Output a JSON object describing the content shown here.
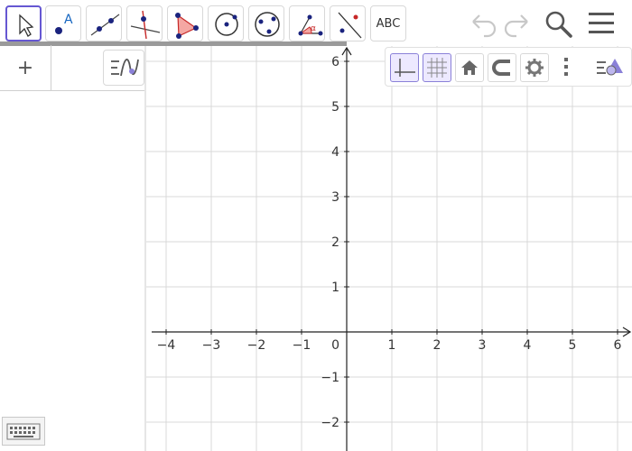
{
  "toolbar": {
    "tools": [
      {
        "name": "move-tool",
        "icon": "pointer-arrow-icon",
        "active": true
      },
      {
        "name": "point-tool",
        "icon": "point-icon"
      },
      {
        "name": "line-tool",
        "icon": "line-through-two-points-icon"
      },
      {
        "name": "perpendicular-tool",
        "icon": "perpendicular-line-icon"
      },
      {
        "name": "polygon-tool",
        "icon": "polygon-icon"
      },
      {
        "name": "circle-tool",
        "icon": "circle-center-point-icon"
      },
      {
        "name": "circle-three-points-tool",
        "icon": "circle-three-points-icon"
      },
      {
        "name": "angle-tool",
        "icon": "angle-icon"
      },
      {
        "name": "reflect-tool",
        "icon": "reflect-about-line-icon"
      },
      {
        "name": "text-tool",
        "icon": "text-icon",
        "label": "ABC"
      }
    ],
    "undo_icon": "undo-icon",
    "redo_icon": "redo-icon",
    "search_icon": "search-icon",
    "menu_icon": "hamburger-menu-icon"
  },
  "algebra": {
    "add_label": "+",
    "style_icon": "algebra-style-icon",
    "keyboard_icon": "keyboard-icon"
  },
  "stylebar": {
    "buttons": [
      {
        "name": "axes-toggle",
        "icon": "axes-icon",
        "on": true
      },
      {
        "name": "grid-toggle",
        "icon": "grid-icon",
        "on": true
      },
      {
        "name": "home-button",
        "icon": "home-icon"
      },
      {
        "name": "point-capturing",
        "icon": "magnet-icon"
      },
      {
        "name": "graphics-settings",
        "icon": "gear-icon"
      },
      {
        "name": "more-options",
        "icon": "vertical-dots-icon"
      },
      {
        "name": "graphics-style-toggle",
        "icon": "style-bar-toggle-icon"
      }
    ]
  },
  "graph": {
    "x_range": [
      -4.3,
      6.3
    ],
    "y_range": [
      -2.6,
      6.2
    ],
    "x_ticks": [
      "−4",
      "−3",
      "−2",
      "−1",
      "1",
      "2",
      "3",
      "4",
      "5",
      "6"
    ],
    "x_tick_values": [
      -4,
      -3,
      -2,
      -1,
      1,
      2,
      3,
      4,
      5,
      6
    ],
    "y_ticks": [
      "6",
      "5",
      "4",
      "3",
      "2",
      "1",
      "−1",
      "−2"
    ],
    "y_tick_values": [
      6,
      5,
      4,
      3,
      2,
      1,
      -1,
      -2
    ],
    "origin_label": "0",
    "grid": true,
    "axis_color": "#222222",
    "grid_color": "#d9d9d9",
    "accent_color": "#6557d2"
  }
}
